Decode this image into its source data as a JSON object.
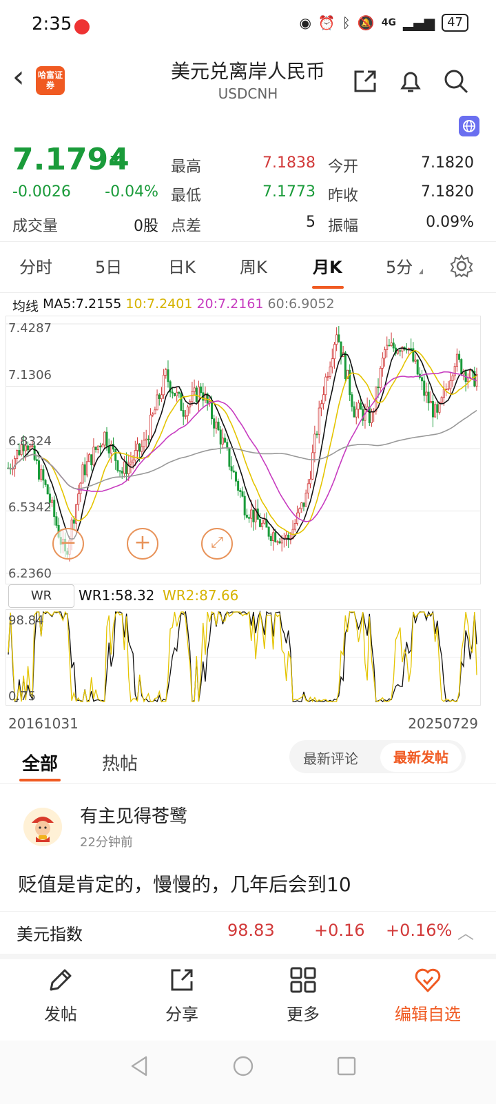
{
  "status": {
    "time": "2:35",
    "network": "4G",
    "battery": "47"
  },
  "header": {
    "back": "‹",
    "brand": "哈富证券",
    "title": "美元兑离岸人民币",
    "subtitle": "USDCNH",
    "icons": [
      "back-icon",
      "share-icon",
      "bell-icon",
      "search-icon",
      "globe-icon"
    ]
  },
  "quote": {
    "price": "7.1794",
    "change": "-0.0026",
    "change_pct": "-0.04%",
    "volume_label": "成交量",
    "volume_value": "0股",
    "stats": [
      {
        "label": "最高",
        "value": "7.1838",
        "color": "#d23a3a"
      },
      {
        "label": "最低",
        "value": "7.1773",
        "color": "#1a9b3a"
      },
      {
        "label": "点差",
        "value": "5",
        "color": "#222222"
      },
      {
        "label": "今开",
        "value": "7.1820",
        "color": "#222222"
      },
      {
        "label": "昨收",
        "value": "7.1820",
        "color": "#222222"
      },
      {
        "label": "振幅",
        "value": "0.09%",
        "color": "#222222"
      }
    ]
  },
  "period_tabs": [
    "分时",
    "5日",
    "日K",
    "周K",
    "月K",
    "5分"
  ],
  "active_period": "月K",
  "ma_legend": {
    "label": "均线",
    "ma5": "MA5:7.2155",
    "ma10": "10:7.2401",
    "ma20": "20:7.2161",
    "ma60": "60:6.9052"
  },
  "colors": {
    "up": "#d23a3a",
    "down": "#1a9b3a",
    "ma5": "#111111",
    "ma10": "#e4c400",
    "ma20": "#c73cc0",
    "ma60": "#999999",
    "accent": "#f05a22"
  },
  "chart_data": {
    "type": "candlestick",
    "y_ticks": [
      "7.4287",
      "7.1306",
      "6.8324",
      "6.5342",
      "6.2360"
    ],
    "ylim": [
      6.236,
      7.4287
    ],
    "x_start": "20161031",
    "x_end": "20250729",
    "wr": {
      "label": "WR",
      "wr1": "WR1:58.32",
      "wr2": "WR2:87.66",
      "y_ticks": [
        "98.84",
        "0.75"
      ]
    }
  },
  "feed": {
    "tabs": [
      "全部",
      "热帖"
    ],
    "sort": [
      "最新评论",
      "最新发帖"
    ],
    "post": {
      "author": "有主见得苍鹭",
      "time": "22分钟前",
      "body": "贬值是肯定的，慢慢的，几年后会到10"
    }
  },
  "index_bar": {
    "name": "美元指数",
    "value": "98.83",
    "change": "+0.16",
    "pct": "+0.16%"
  },
  "toolbar": [
    {
      "label": "发帖",
      "icon": "pencil-icon"
    },
    {
      "label": "分享",
      "icon": "share-icon"
    },
    {
      "label": "更多",
      "icon": "grid-icon"
    },
    {
      "label": "编辑自选",
      "icon": "heart-icon"
    }
  ]
}
